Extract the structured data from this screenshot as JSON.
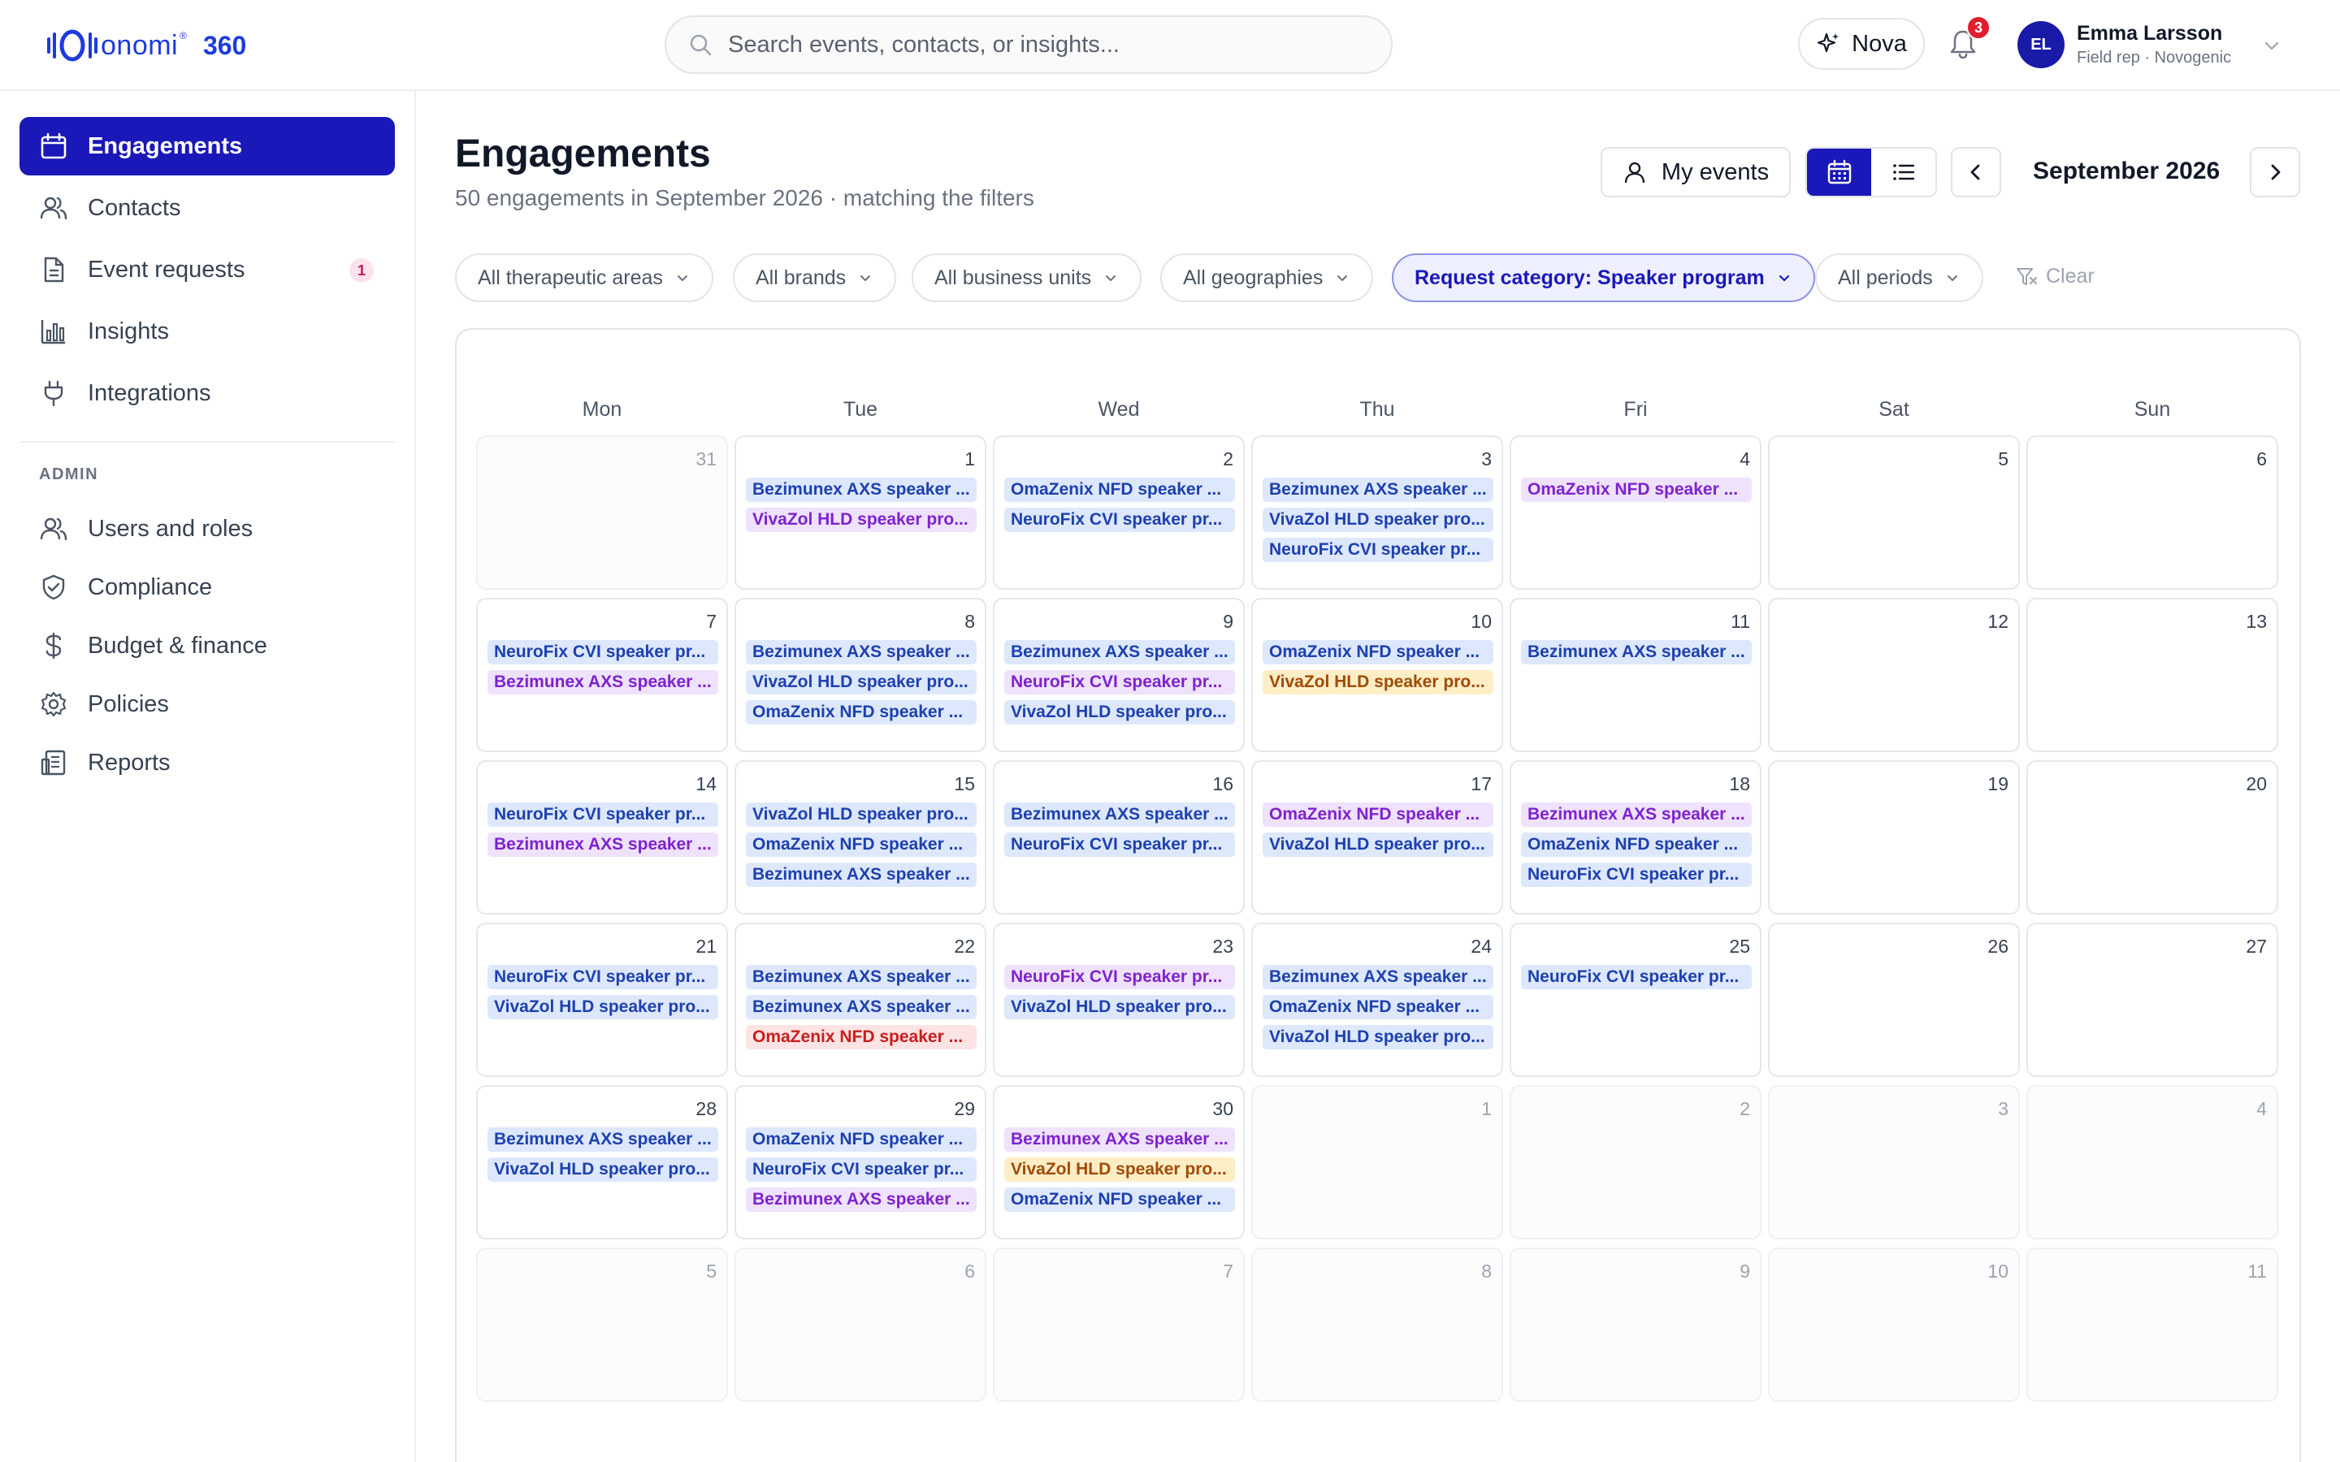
{
  "brand": {
    "word": "onomi",
    "reg": "®",
    "suffix": "360",
    "accent": "#1d3be0"
  },
  "search": {
    "placeholder": "Search events, contacts, or insights..."
  },
  "header": {
    "nova_label": "Nova",
    "notifications_count": "3",
    "user": {
      "initials": "EL",
      "name": "Emma Larsson",
      "role": "Field rep · Novogenic"
    }
  },
  "sidebar": {
    "items": [
      {
        "label": "Engagements",
        "icon": "calendar-icon",
        "active": true
      },
      {
        "label": "Contacts",
        "icon": "users-icon"
      },
      {
        "label": "Event requests",
        "icon": "document-icon",
        "badge": "1"
      },
      {
        "label": "Insights",
        "icon": "bar-chart-icon"
      },
      {
        "label": "Integrations",
        "icon": "plug-icon"
      }
    ],
    "admin_label": "ADMIN",
    "admin_items": [
      {
        "label": "Users and roles",
        "icon": "users-icon"
      },
      {
        "label": "Compliance",
        "icon": "shield-check-icon"
      },
      {
        "label": "Budget & finance",
        "icon": "dollar-icon"
      },
      {
        "label": "Policies",
        "icon": "gear-icon"
      },
      {
        "label": "Reports",
        "icon": "report-icon"
      }
    ]
  },
  "main": {
    "title": "Engagements",
    "subtitle": "50 engagements in September 2026 · matching the filters",
    "my_events_label": "My events",
    "month_label": "September 2026",
    "filters": [
      {
        "label": "All therapeutic areas"
      },
      {
        "label": "All brands"
      },
      {
        "label": "All business units"
      },
      {
        "label": "All geographies"
      },
      {
        "label": "Request category: Speaker program",
        "active": true
      },
      {
        "label": "All periods"
      }
    ],
    "clear_label": "Clear"
  },
  "colors": {
    "primary": "#1a18b8",
    "blue_event": "#dde8fd",
    "purple_event": "#efe2fd",
    "red_event": "#fde3e3",
    "yellow_event": "#fdeec6"
  },
  "calendar": {
    "weekdays": [
      "Mon",
      "Tue",
      "Wed",
      "Thu",
      "Fri",
      "Sat",
      "Sun"
    ],
    "weeks": [
      [
        {
          "day": "31",
          "out": true,
          "events": []
        },
        {
          "day": "1",
          "events": [
            {
              "label": "Bezimunex AXS speaker ...",
              "color": "blue"
            },
            {
              "label": "VivaZol HLD speaker pro...",
              "color": "purple"
            }
          ]
        },
        {
          "day": "2",
          "events": [
            {
              "label": "OmaZenix NFD speaker ...",
              "color": "blue"
            },
            {
              "label": "NeuroFix CVI speaker pr...",
              "color": "blue"
            }
          ]
        },
        {
          "day": "3",
          "events": [
            {
              "label": "Bezimunex AXS speaker ...",
              "color": "blue"
            },
            {
              "label": "VivaZol HLD speaker pro...",
              "color": "blue"
            },
            {
              "label": "NeuroFix CVI speaker pr...",
              "color": "blue"
            }
          ]
        },
        {
          "day": "4",
          "events": [
            {
              "label": "OmaZenix NFD speaker ...",
              "color": "purple"
            }
          ]
        },
        {
          "day": "5",
          "events": []
        },
        {
          "day": "6",
          "events": []
        }
      ],
      [
        {
          "day": "7",
          "events": [
            {
              "label": "NeuroFix CVI speaker pr...",
              "color": "blue"
            },
            {
              "label": "Bezimunex AXS speaker ...",
              "color": "purple"
            }
          ]
        },
        {
          "day": "8",
          "events": [
            {
              "label": "Bezimunex AXS speaker ...",
              "color": "blue"
            },
            {
              "label": "VivaZol HLD speaker pro...",
              "color": "blue"
            },
            {
              "label": "OmaZenix NFD speaker ...",
              "color": "blue"
            }
          ]
        },
        {
          "day": "9",
          "events": [
            {
              "label": "Bezimunex AXS speaker ...",
              "color": "blue"
            },
            {
              "label": "NeuroFix CVI speaker pr...",
              "color": "purple"
            },
            {
              "label": "VivaZol HLD speaker pro...",
              "color": "blue"
            }
          ]
        },
        {
          "day": "10",
          "events": [
            {
              "label": "OmaZenix NFD speaker ...",
              "color": "blue"
            },
            {
              "label": "VivaZol HLD speaker pro...",
              "color": "yellow"
            }
          ]
        },
        {
          "day": "11",
          "events": [
            {
              "label": "Bezimunex AXS speaker ...",
              "color": "blue"
            }
          ]
        },
        {
          "day": "12",
          "events": []
        },
        {
          "day": "13",
          "events": []
        }
      ],
      [
        {
          "day": "14",
          "events": [
            {
              "label": "NeuroFix CVI speaker pr...",
              "color": "blue"
            },
            {
              "label": "Bezimunex AXS speaker ...",
              "color": "purple"
            }
          ]
        },
        {
          "day": "15",
          "events": [
            {
              "label": "VivaZol HLD speaker pro...",
              "color": "blue"
            },
            {
              "label": "OmaZenix NFD speaker ...",
              "color": "blue"
            },
            {
              "label": "Bezimunex AXS speaker ...",
              "color": "blue"
            }
          ]
        },
        {
          "day": "16",
          "events": [
            {
              "label": "Bezimunex AXS speaker ...",
              "color": "blue"
            },
            {
              "label": "NeuroFix CVI speaker pr...",
              "color": "blue"
            }
          ]
        },
        {
          "day": "17",
          "events": [
            {
              "label": "OmaZenix NFD speaker ...",
              "color": "purple"
            },
            {
              "label": "VivaZol HLD speaker pro...",
              "color": "blue"
            }
          ]
        },
        {
          "day": "18",
          "events": [
            {
              "label": "Bezimunex AXS speaker ...",
              "color": "purple"
            },
            {
              "label": "OmaZenix NFD speaker ...",
              "color": "blue"
            },
            {
              "label": "NeuroFix CVI speaker pr...",
              "color": "blue"
            }
          ]
        },
        {
          "day": "19",
          "events": []
        },
        {
          "day": "20",
          "events": []
        }
      ],
      [
        {
          "day": "21",
          "events": [
            {
              "label": "NeuroFix CVI speaker pr...",
              "color": "blue"
            },
            {
              "label": "VivaZol HLD speaker pro...",
              "color": "blue"
            }
          ]
        },
        {
          "day": "22",
          "events": [
            {
              "label": "Bezimunex AXS speaker ...",
              "color": "blue"
            },
            {
              "label": "Bezimunex AXS speaker ...",
              "color": "blue"
            },
            {
              "label": "OmaZenix NFD speaker ...",
              "color": "red"
            }
          ]
        },
        {
          "day": "23",
          "events": [
            {
              "label": "NeuroFix CVI speaker pr...",
              "color": "purple"
            },
            {
              "label": "VivaZol HLD speaker pro...",
              "color": "blue"
            }
          ]
        },
        {
          "day": "24",
          "events": [
            {
              "label": "Bezimunex AXS speaker ...",
              "color": "blue"
            },
            {
              "label": "OmaZenix NFD speaker ...",
              "color": "blue"
            },
            {
              "label": "VivaZol HLD speaker pro...",
              "color": "blue"
            }
          ]
        },
        {
          "day": "25",
          "events": [
            {
              "label": "NeuroFix CVI speaker pr...",
              "color": "blue"
            }
          ]
        },
        {
          "day": "26",
          "events": []
        },
        {
          "day": "27",
          "events": []
        }
      ],
      [
        {
          "day": "28",
          "events": [
            {
              "label": "Bezimunex AXS speaker ...",
              "color": "blue"
            },
            {
              "label": "VivaZol HLD speaker pro...",
              "color": "blue"
            }
          ]
        },
        {
          "day": "29",
          "events": [
            {
              "label": "OmaZenix NFD speaker ...",
              "color": "blue"
            },
            {
              "label": "NeuroFix CVI speaker pr...",
              "color": "blue"
            },
            {
              "label": "Bezimunex AXS speaker ...",
              "color": "purple"
            }
          ]
        },
        {
          "day": "30",
          "events": [
            {
              "label": "Bezimunex AXS speaker ...",
              "color": "purple"
            },
            {
              "label": "VivaZol HLD speaker pro...",
              "color": "yellow"
            },
            {
              "label": "OmaZenix NFD speaker ...",
              "color": "blue"
            }
          ]
        },
        {
          "day": "1",
          "out": true,
          "events": []
        },
        {
          "day": "2",
          "out": true,
          "events": []
        },
        {
          "day": "3",
          "out": true,
          "events": []
        },
        {
          "day": "4",
          "out": true,
          "events": []
        }
      ],
      [
        {
          "day": "5",
          "out": true,
          "events": []
        },
        {
          "day": "6",
          "out": true,
          "events": []
        },
        {
          "day": "7",
          "out": true,
          "events": []
        },
        {
          "day": "8",
          "out": true,
          "events": []
        },
        {
          "day": "9",
          "out": true,
          "events": []
        },
        {
          "day": "10",
          "out": true,
          "events": []
        },
        {
          "day": "11",
          "out": true,
          "events": []
        }
      ]
    ]
  }
}
